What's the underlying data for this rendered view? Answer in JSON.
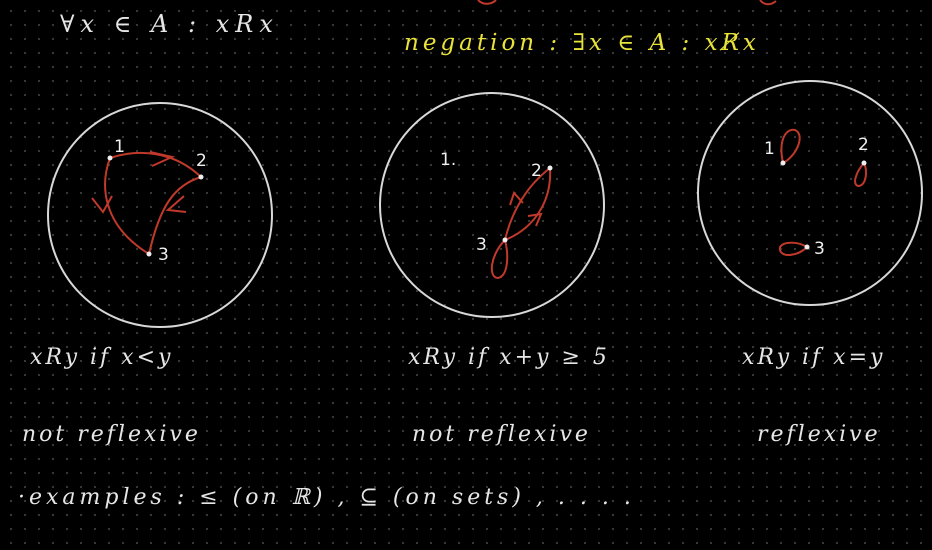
{
  "header": {
    "definition": "∀x ∈ A : xRx",
    "negation": "negation : ∃x ∈ A : xR̸x"
  },
  "colors": {
    "background": "#000000",
    "circle": "#d8d8d8",
    "edge": "#c0392b",
    "negation_text": "#e8e23a",
    "text": "#e6e6e6"
  },
  "diagrams": [
    {
      "nodes": [
        "1",
        "2",
        "3"
      ],
      "caption": "xRy if x<y",
      "verdict": "not reflexive"
    },
    {
      "nodes": [
        "1.",
        "2",
        "3"
      ],
      "caption": "xRy if x+y ≥ 5",
      "verdict": "not reflexive"
    },
    {
      "nodes": [
        "1",
        "2",
        "3"
      ],
      "caption": "xRy if x=y",
      "verdict": "reflexive"
    }
  ],
  "footer": {
    "examples": "·examples :   ≤  (on ℝ) ,  ⊆ (on sets) , . . . ."
  }
}
